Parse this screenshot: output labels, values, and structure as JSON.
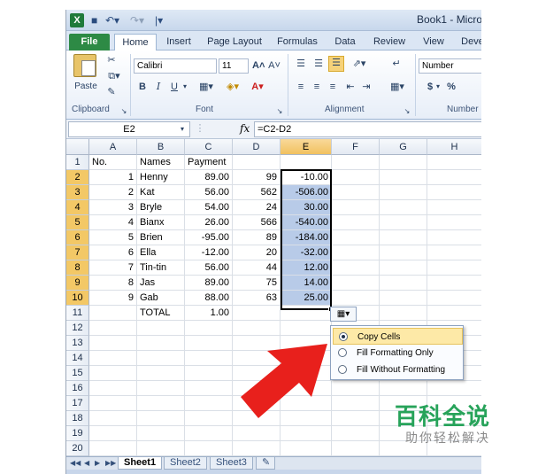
{
  "window": {
    "title": "Book1 - Micro"
  },
  "quick_access": {
    "undo_icon": "undo-icon",
    "redo_icon": "redo-icon"
  },
  "ribbon_tabs": [
    {
      "label": "File"
    },
    {
      "label": "Home"
    },
    {
      "label": "Insert"
    },
    {
      "label": "Page Layout"
    },
    {
      "label": "Formulas"
    },
    {
      "label": "Data"
    },
    {
      "label": "Review"
    },
    {
      "label": "View"
    },
    {
      "label": "Deve"
    }
  ],
  "ribbon": {
    "paste_label": "Paste",
    "font_name": "Calibri",
    "font_size": "11",
    "bold": "B",
    "italic": "I",
    "underline": "U",
    "number_format": "Number",
    "currency": "$",
    "percent": "%",
    "groups": {
      "clipboard": "Clipboard",
      "font": "Font",
      "alignment": "Alignment",
      "number": "Number"
    }
  },
  "formula_bar": {
    "name_box": "E2",
    "fx": "fx",
    "formula": "=C2-D2"
  },
  "columns": [
    "A",
    "B",
    "C",
    "D",
    "E",
    "F",
    "G",
    "H"
  ],
  "rows": [
    {
      "n": "1",
      "A": "No.",
      "B": "Names",
      "C": "Payment",
      "D": "",
      "E": ""
    },
    {
      "n": "2",
      "A": "1",
      "B": "Henny",
      "C": "89.00",
      "D": "99",
      "E": "-10.00"
    },
    {
      "n": "3",
      "A": "2",
      "B": "Kat",
      "C": "56.00",
      "D": "562",
      "E": "-506.00"
    },
    {
      "n": "4",
      "A": "3",
      "B": "Bryle",
      "C": "54.00",
      "D": "24",
      "E": "30.00"
    },
    {
      "n": "5",
      "A": "4",
      "B": "Bianx",
      "C": "26.00",
      "D": "566",
      "E": "-540.00"
    },
    {
      "n": "6",
      "A": "5",
      "B": "Brien",
      "C": "-95.00",
      "D": "89",
      "E": "-184.00"
    },
    {
      "n": "7",
      "A": "6",
      "B": "Ella",
      "C": "-12.00",
      "D": "20",
      "E": "-32.00"
    },
    {
      "n": "8",
      "A": "7",
      "B": "Tin-tin",
      "C": "56.00",
      "D": "44",
      "E": "12.00"
    },
    {
      "n": "9",
      "A": "8",
      "B": "Jas",
      "C": "89.00",
      "D": "75",
      "E": "14.00"
    },
    {
      "n": "10",
      "A": "9",
      "B": "Gab",
      "C": "88.00",
      "D": "63",
      "E": "25.00"
    },
    {
      "n": "11",
      "A": "",
      "B": "TOTAL",
      "C": "1.00",
      "D": "",
      "E": ""
    },
    {
      "n": "12"
    },
    {
      "n": "13"
    },
    {
      "n": "14"
    },
    {
      "n": "15"
    },
    {
      "n": "16"
    },
    {
      "n": "17"
    },
    {
      "n": "18"
    },
    {
      "n": "19"
    },
    {
      "n": "20"
    }
  ],
  "autofill_menu": {
    "items": [
      {
        "label": "Copy Cells",
        "selected": true
      },
      {
        "label": "Fill Formatting Only",
        "selected": false
      },
      {
        "label": "Fill Without Formatting",
        "selected": false
      }
    ]
  },
  "sheet_tabs": [
    {
      "label": "Sheet1"
    },
    {
      "label": "Sheet2"
    },
    {
      "label": "Sheet3"
    }
  ],
  "annotation": {
    "arrow_color": "#e8201c"
  },
  "watermark": {
    "main": "百科全说",
    "sub": "助你轻松解决"
  },
  "colors": {
    "selection": "#b8cbe8",
    "header_selected": "#f3c866",
    "file_tab": "#2d8a45"
  }
}
